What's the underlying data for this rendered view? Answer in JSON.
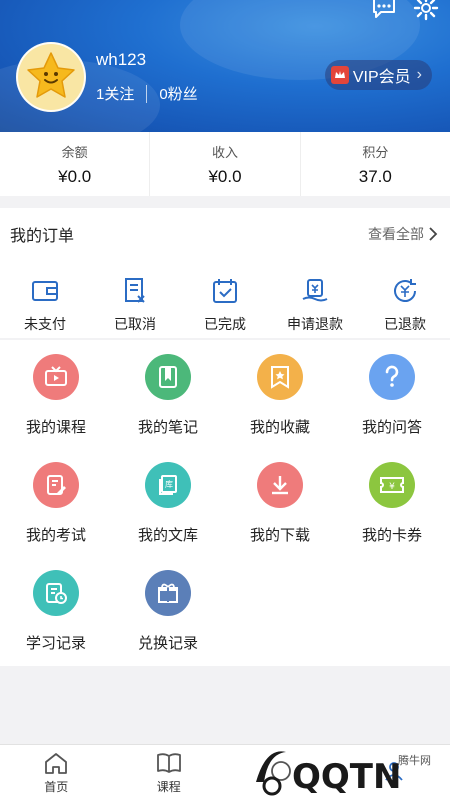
{
  "profile": {
    "username": "wh123",
    "following": "1关注",
    "fans": "0粉丝",
    "vip_label": "VIP会员"
  },
  "stats": [
    {
      "label": "余额",
      "value": "¥0.0"
    },
    {
      "label": "收入",
      "value": "¥0.0"
    },
    {
      "label": "积分",
      "value": "37.0"
    }
  ],
  "orders": {
    "title": "我的订单",
    "view_all": "查看全部",
    "items": [
      {
        "label": "未支付",
        "icon": "wallet-icon"
      },
      {
        "label": "已取消",
        "icon": "cancelled-icon"
      },
      {
        "label": "已完成",
        "icon": "completed-icon"
      },
      {
        "label": "申请退款",
        "icon": "refund-request-icon"
      },
      {
        "label": "已退款",
        "icon": "refunded-icon"
      }
    ]
  },
  "grid": [
    {
      "label": "我的课程",
      "icon": "course-icon",
      "color": "#ef7b7b"
    },
    {
      "label": "我的笔记",
      "icon": "notes-icon",
      "color": "#4cb87a"
    },
    {
      "label": "我的收藏",
      "icon": "favorites-icon",
      "color": "#f3b14a"
    },
    {
      "label": "我的问答",
      "icon": "question-icon",
      "color": "#6aa3f0"
    },
    {
      "label": "我的考试",
      "icon": "exam-icon",
      "color": "#ef7b7b"
    },
    {
      "label": "我的文库",
      "icon": "library-icon",
      "color": "#3fc0b8"
    },
    {
      "label": "我的下载",
      "icon": "download-icon",
      "color": "#ef7b7b"
    },
    {
      "label": "我的卡券",
      "icon": "coupon-icon",
      "color": "#8cc63f"
    },
    {
      "label": "学习记录",
      "icon": "study-record-icon",
      "color": "#3fc0b8"
    },
    {
      "label": "兑换记录",
      "icon": "gift-icon",
      "color": "#5b7fb8"
    }
  ],
  "nav": [
    {
      "label": "首页",
      "icon": "home-icon"
    },
    {
      "label": "课程",
      "icon": "book-icon"
    },
    {
      "label": "",
      "icon": "discover-icon"
    },
    {
      "label": "",
      "icon": "profile-icon"
    }
  ],
  "watermark": {
    "text": "QQTN",
    "small": "腾牛网"
  },
  "colors": {
    "header_blue": "#1f6fd0",
    "order_icon_blue": "#2b6cc4"
  }
}
